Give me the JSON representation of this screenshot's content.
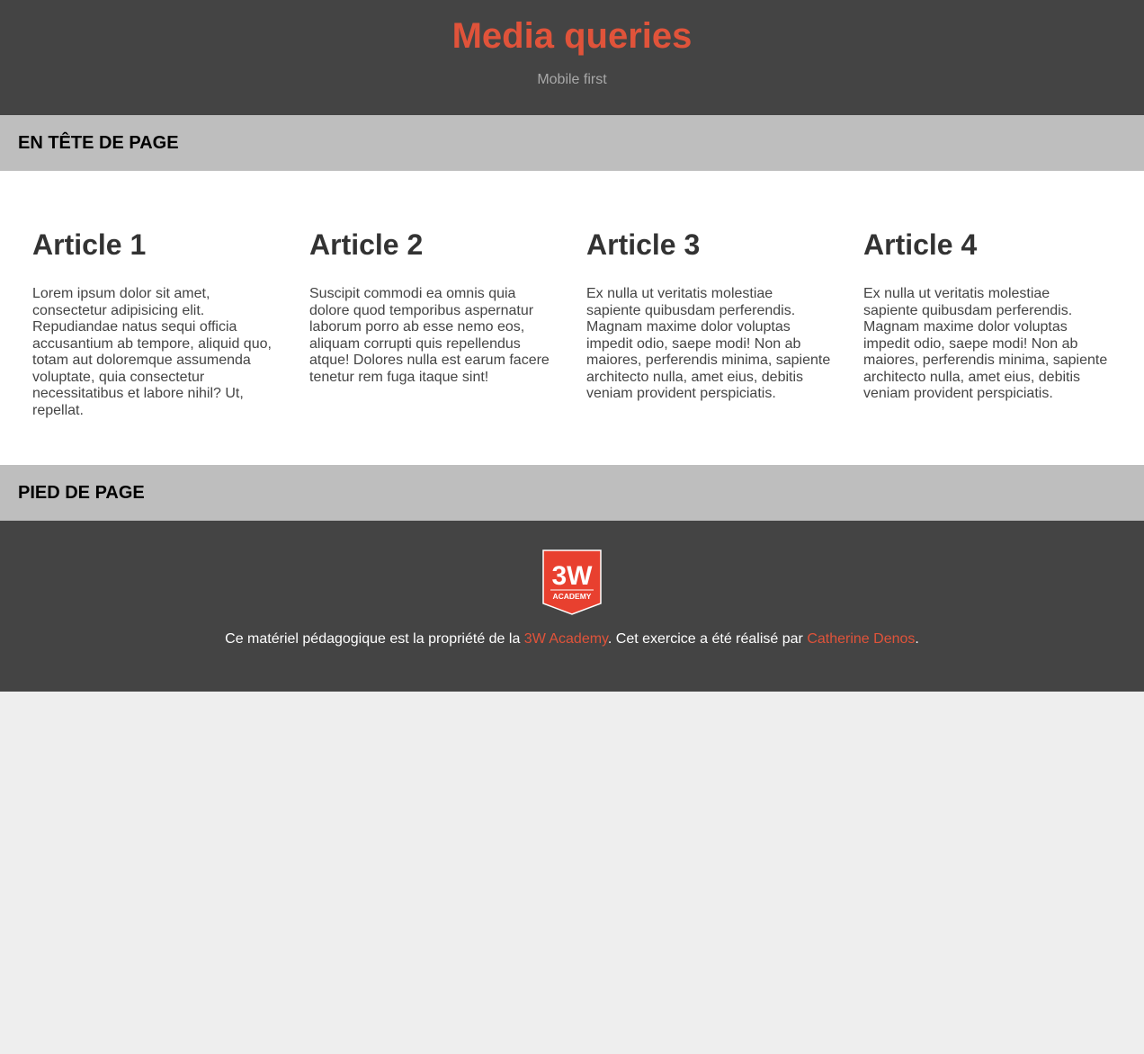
{
  "banner": {
    "title": "Media queries",
    "subtitle": "Mobile first"
  },
  "header_bar": {
    "label": "EN TÊTE DE PAGE"
  },
  "articles": [
    {
      "title": "Article 1",
      "body": "Lorem ipsum dolor sit amet, consectetur adipisicing elit. Repudiandae natus sequi officia accusantium ab tempore, aliquid quo, totam aut doloremque assumenda voluptate, quia consectetur necessitatibus et labore nihil? Ut, repellat."
    },
    {
      "title": "Article 2",
      "body": "Suscipit commodi ea omnis quia dolore quod temporibus aspernatur laborum porro ab esse nemo eos, aliquam corrupti quis repellendus atque! Dolores nulla est earum facere tenetur rem fuga itaque sint!"
    },
    {
      "title": "Article 3",
      "body": "Ex nulla ut veritatis molestiae sapiente quibusdam perferendis. Magnam maxime dolor voluptas impedit odio, saepe modi! Non ab maiores, perferendis minima, sapiente architecto nulla, amet eius, debitis veniam provident perspiciatis."
    },
    {
      "title": "Article 4",
      "body": "Ex nulla ut veritatis molestiae sapiente quibusdam perferendis. Magnam maxime dolor voluptas impedit odio, saepe modi! Non ab maiores, perferendis minima, sapiente architecto nulla, amet eius, debitis veniam provident perspiciatis."
    }
  ],
  "footer_bar": {
    "label": "PIED DE PAGE"
  },
  "footer": {
    "logo": {
      "icon": "3w-academy-logo-icon",
      "text_main": "3W",
      "text_sub": "ACADEMY",
      "color": "#e8402f"
    },
    "credits_part1": "Ce matériel pédagogique est la propriété de la ",
    "link_academy": "3W Academy",
    "credits_part2": ". Cet exercice a été réalisé par ",
    "link_author": "Catherine Denos",
    "credits_part3": "."
  },
  "colors": {
    "accent": "#e0533a",
    "dark_background": "#444444",
    "bar_background": "#bebebe",
    "page_background": "#eeeeee"
  }
}
